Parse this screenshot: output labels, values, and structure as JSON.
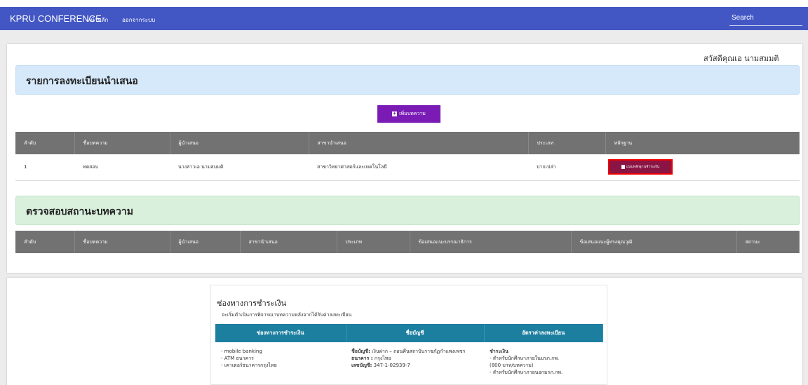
{
  "navbar": {
    "brand": "KPRU CONFERENCE",
    "links": [
      "หน้าหลัก",
      "ออกจากระบบ"
    ],
    "search_placeholder": "Search",
    "bg_color": "#4357c4"
  },
  "greeting": "สวัสดีคุณเอ นามสมมติ",
  "registration": {
    "title": "รายการลงทะเบียนนำเสนอ",
    "add_button": "เพิ่มบทความ",
    "columns": [
      "ลำดับ",
      "ชื่อบทความ",
      "ผู้นำเสนอ",
      "สาขานำเสนอ",
      "ประเภท",
      "หลักฐาน"
    ],
    "rows": [
      {
        "no": "1",
        "title": "ทดสอบ",
        "presenter": "นางสาวเอ นามสมมติ",
        "field": "สาขาวิทยาศาสตร์และเทคโนโลยี",
        "type": "ปากเปล่า",
        "proof_button": "แนบหลักฐานชำระเงิน"
      }
    ]
  },
  "status": {
    "title": "ตรวจสอบสถานะบทความ",
    "columns": [
      "ลำดับ",
      "ชื่อบทความ",
      "ผู้นำเสนอ",
      "สาขานำเสนอ",
      "ประเภท",
      "ข้อเสนอแนะบรรณาธิการ",
      "ข้อเสนอแนะผู้ทรงคุณวุฒิ",
      "สถานะ"
    ]
  },
  "payment": {
    "title": "ช่องทางการชำระเงิน",
    "note": "จะเริ่มดำเนินการพิจารณาบทความหลังจากได้รับค่าลงทะเบียน",
    "columns": [
      "ช่องทางการชำระเงิน",
      "ชื่อบัญชี",
      "อัตราค่าลงทะเบียน"
    ],
    "channels": [
      "- mobile banking",
      "- ATM ธนาคาร",
      "- เคาเตอร์ธนาคารกรุงไทย"
    ],
    "account": {
      "name_label": "ชื่อบัญชี:",
      "name_value": "เงินฝาก – ถอนคืนสถาบันราชภัฏกำแพงเพชร",
      "bank_label": "ธนาคาร :",
      "bank_value": "กรุงไทย",
      "number_label": "เลขบัญชี:",
      "number_value": "347-1-02939-7"
    },
    "rates": {
      "heading": "ชำระเงิน",
      "lines": [
        "- สำหรับนักศึกษาภายในมรภ.กพ.",
        "(800 บาท/บทความ)",
        "- สำหรับนักศึกษาภายนอกมรภ.กพ."
      ]
    }
  },
  "colors": {
    "add_button": "#7a1bb5",
    "proof_button": "#8a1545",
    "proof_highlight": "#e00000",
    "table_header": "#727272",
    "payment_header": "#1d7fa0",
    "panel_blue": "#d6e9fb",
    "panel_green": "#d9f0dc"
  }
}
